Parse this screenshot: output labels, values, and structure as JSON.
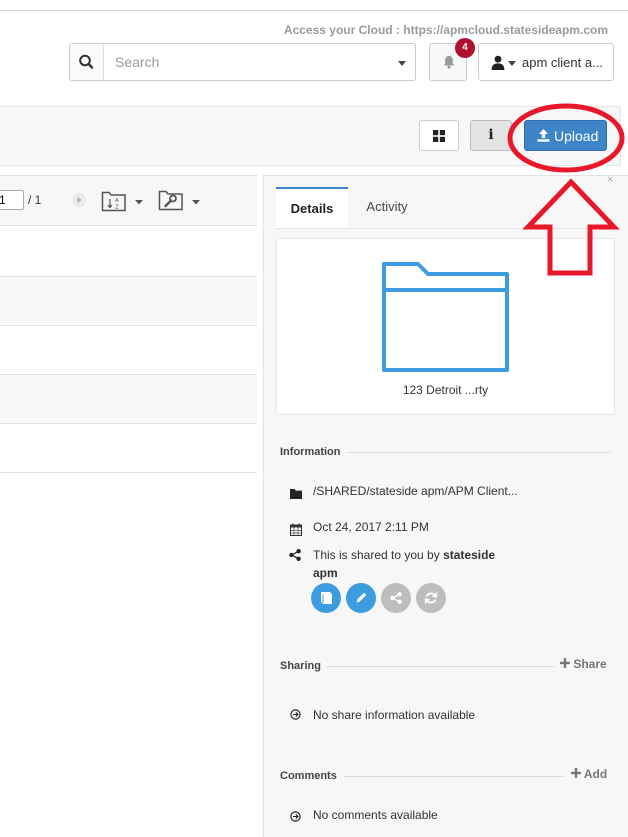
{
  "header": {
    "access_url": "Access your Cloud : https://apmcloud.statesideapm.com",
    "search_placeholder": "Search",
    "notification_count": "4",
    "user_label": "apm client a..."
  },
  "toolbar": {
    "info_label": "i",
    "upload_label": "Upload"
  },
  "listbar": {
    "page_value": "1",
    "page_total": "/ 1"
  },
  "panel": {
    "tabs": [
      "Details",
      "Activity"
    ],
    "close_label": "×",
    "item_name": "123 Detroit ...rty",
    "information_title": "Information",
    "path": "/SHARED/stateside apm/APM Client...",
    "date": "Oct 24, 2017 2:11 PM",
    "shared_prefix": "This is shared to you by ",
    "shared_by_line1": "stateside",
    "shared_by_line2": "apm",
    "sharing_title": "Sharing",
    "share_add_label": "Share",
    "no_share_text": "No share information available",
    "comments_title": "Comments",
    "comment_add_label": "Add",
    "no_comments_text": "No comments available"
  },
  "colors": {
    "primary": "#3d85c6",
    "badge": "#b0102b",
    "annotation": "#e8182a",
    "folder_stroke": "#3d9be0"
  }
}
